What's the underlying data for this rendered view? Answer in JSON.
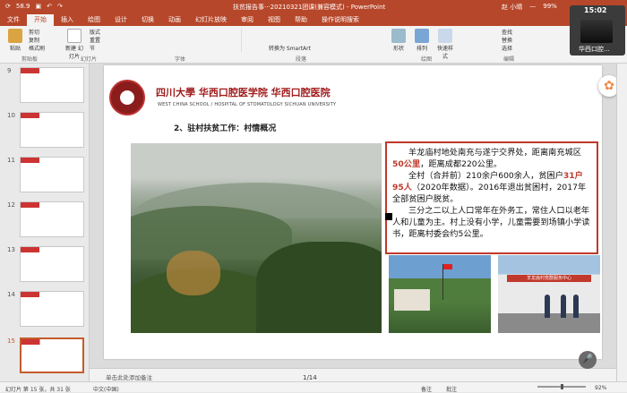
{
  "titlebar": {
    "autosave": "58.9",
    "document_title": "扶贫报告事···20210321团课(兼容模式) - PowerPoint",
    "user": "赵 小晴",
    "battery": "99%"
  },
  "tabs": [
    "文件",
    "开始",
    "插入",
    "绘图",
    "设计",
    "切换",
    "动画",
    "幻灯片放映",
    "审阅",
    "视图",
    "帮助",
    "操作说明搜索"
  ],
  "ribbon": {
    "paste": "粘贴",
    "cut": "剪切",
    "copy": "复制",
    "format_painter": "格式刷",
    "clipboard": "剪贴板",
    "new_slide": "新建\n幻灯片",
    "layout": "版式",
    "reset": "重置",
    "section": "节",
    "slides": "幻灯片",
    "font": "字体",
    "paragraph": "段落",
    "convert_smartart": "转换为 SmartArt",
    "shapes": "形状",
    "arrange": "排列",
    "quick_styles": "快速样式",
    "drawing": "绘图",
    "find": "查找",
    "replace": "替换",
    "select": "选择",
    "editing": "编辑"
  },
  "thumbnails": [
    {
      "num": "9"
    },
    {
      "num": "10"
    },
    {
      "num": "11"
    },
    {
      "num": "12"
    },
    {
      "num": "13"
    },
    {
      "num": "14"
    },
    {
      "num": "15"
    }
  ],
  "slide": {
    "university_cn": "四川大學  华西口腔医学院  华西口腔医院",
    "university_en": "WEST CHINA SCHOOL / HOSPITAL OF STOMATOLOGY SICHUAN UNIVERSITY",
    "heading": "2、驻村扶贫工作：村情概况",
    "para1_a": "羊龙庙村地处南充与遂宁交界处，距离南充城区",
    "para1_b": "50公里",
    "para1_c": "，距离成都220公里。",
    "para2_a": "全村（合并前）210余户600余人，贫困户",
    "para2_b": "31户95人",
    "para2_c": "（2020年数据）。2016年退出贫困村，2017年全部贫困户脱贫。",
    "para3": "三分之二以上人口常年在外务工，常住人口以老年人和儿童为主。村上没有小学，儿童需要到场镇小学读书，距离村委会约5公里。",
    "sign_text": "羊龙庙村党群服务中心"
  },
  "notes": "单击此处添加备注",
  "page_indicator": "1/14",
  "status": {
    "slide_info": "幻灯片 第 15 张，共 31 张",
    "language": "中文(中国)",
    "notes_btn": "备注",
    "comments_btn": "批注",
    "zoom": "92%"
  },
  "video": {
    "time": "15:02",
    "name": "华西口腔..."
  }
}
